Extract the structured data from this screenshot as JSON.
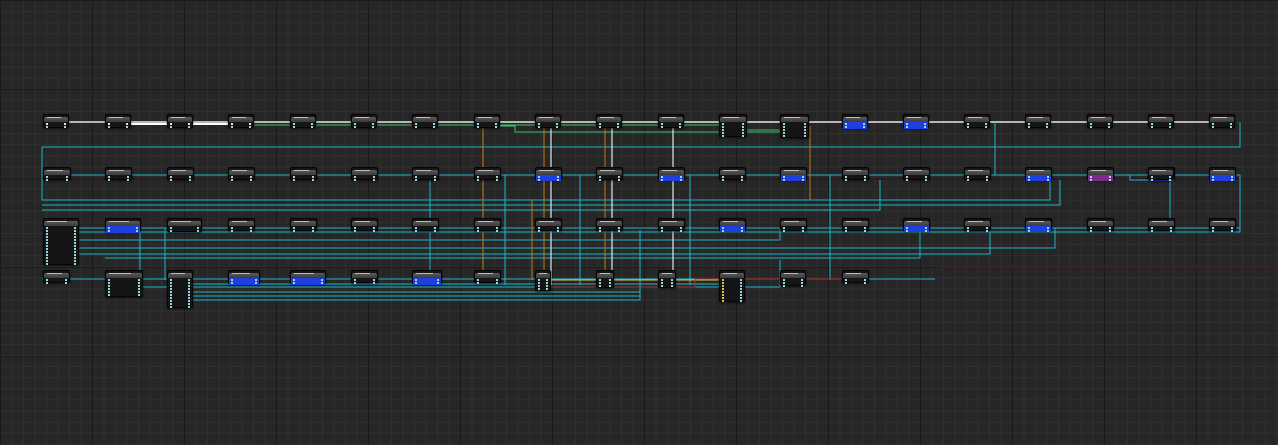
{
  "editor": {
    "view": "node-graph",
    "grid": true
  },
  "colors": {
    "background": "#262626",
    "grid_major": "#1a1a1a",
    "grid_minor": "#303030",
    "wire_data": "#1fb4cf",
    "wire_exec": "#e6e6e6",
    "wire_green": "#3fbf6a",
    "wire_orange": "#c77a12",
    "wire_red": "#a83232",
    "node_body": "#151515",
    "node_header": "#4a4a4a",
    "node_tint_blue": "#1f3ee0",
    "node_tint_purple": "#7d2a8c"
  },
  "nodes": {
    "row1": [
      "exec",
      "exec",
      "exec",
      "exec",
      "plain",
      "plain",
      "plain",
      "plain",
      "plain",
      "plain",
      "plain",
      "plain",
      "plain",
      "blue",
      "blue",
      "plain",
      "plain",
      "plain",
      "plain",
      "plain"
    ],
    "row2": [
      "plain",
      "plain",
      "plain",
      "plain",
      "plain",
      "plain",
      "plain",
      "plain",
      "blue",
      "plain",
      "blue",
      "plain",
      "blue",
      "plain",
      "plain",
      "plain",
      "blue",
      "purple",
      "blue",
      "plain",
      "blue"
    ],
    "row3": [
      "plain",
      "blue",
      "plain",
      "plain",
      "plain",
      "plain",
      "plain",
      "plain",
      "plain",
      "plain",
      "plain",
      "blue",
      "plain",
      "plain",
      "blue",
      "plain",
      "blue",
      "plain",
      "plain",
      "plain"
    ],
    "row4": [
      "plain",
      "plain",
      "plain",
      "blue",
      "blue",
      "plain",
      "blue",
      "plain",
      "plain",
      "plain",
      "plain",
      "plain",
      "plain",
      "plain"
    ]
  }
}
